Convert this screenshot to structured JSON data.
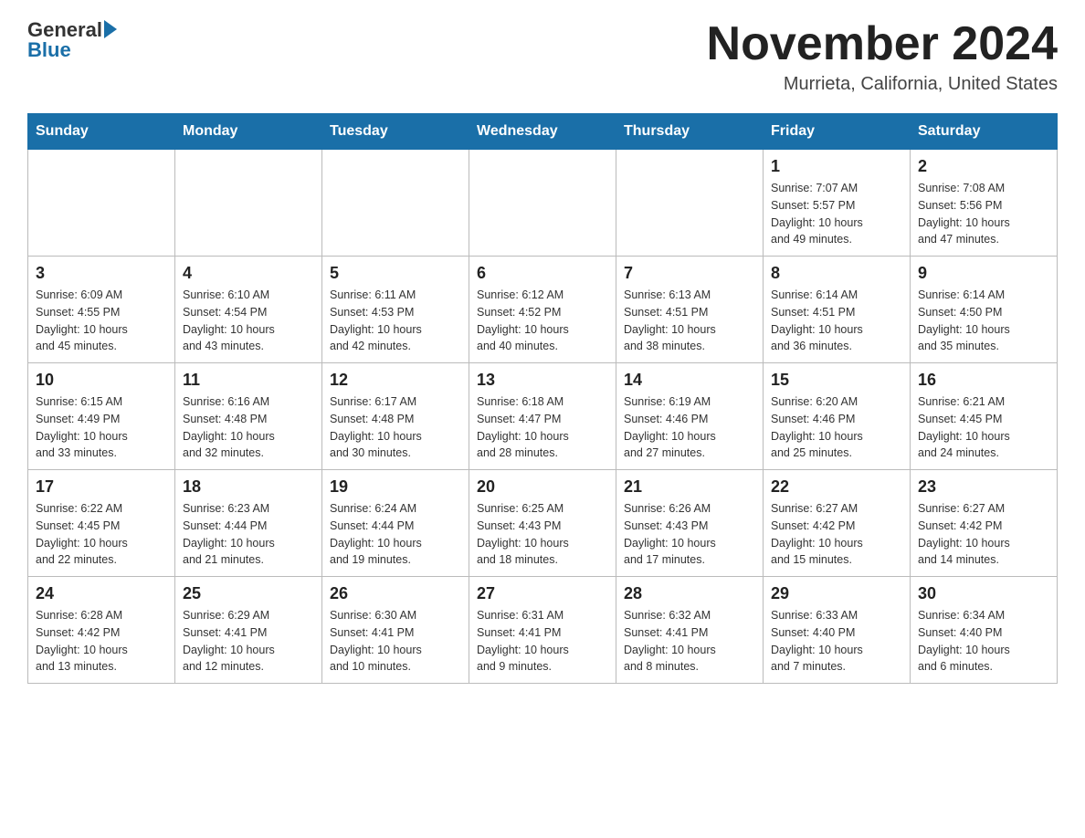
{
  "header": {
    "logo_general": "General",
    "logo_blue": "Blue",
    "title": "November 2024",
    "subtitle": "Murrieta, California, United States"
  },
  "days_of_week": [
    "Sunday",
    "Monday",
    "Tuesday",
    "Wednesday",
    "Thursday",
    "Friday",
    "Saturday"
  ],
  "weeks": [
    [
      {
        "day": "",
        "info": ""
      },
      {
        "day": "",
        "info": ""
      },
      {
        "day": "",
        "info": ""
      },
      {
        "day": "",
        "info": ""
      },
      {
        "day": "",
        "info": ""
      },
      {
        "day": "1",
        "info": "Sunrise: 7:07 AM\nSunset: 5:57 PM\nDaylight: 10 hours\nand 49 minutes."
      },
      {
        "day": "2",
        "info": "Sunrise: 7:08 AM\nSunset: 5:56 PM\nDaylight: 10 hours\nand 47 minutes."
      }
    ],
    [
      {
        "day": "3",
        "info": "Sunrise: 6:09 AM\nSunset: 4:55 PM\nDaylight: 10 hours\nand 45 minutes."
      },
      {
        "day": "4",
        "info": "Sunrise: 6:10 AM\nSunset: 4:54 PM\nDaylight: 10 hours\nand 43 minutes."
      },
      {
        "day": "5",
        "info": "Sunrise: 6:11 AM\nSunset: 4:53 PM\nDaylight: 10 hours\nand 42 minutes."
      },
      {
        "day": "6",
        "info": "Sunrise: 6:12 AM\nSunset: 4:52 PM\nDaylight: 10 hours\nand 40 minutes."
      },
      {
        "day": "7",
        "info": "Sunrise: 6:13 AM\nSunset: 4:51 PM\nDaylight: 10 hours\nand 38 minutes."
      },
      {
        "day": "8",
        "info": "Sunrise: 6:14 AM\nSunset: 4:51 PM\nDaylight: 10 hours\nand 36 minutes."
      },
      {
        "day": "9",
        "info": "Sunrise: 6:14 AM\nSunset: 4:50 PM\nDaylight: 10 hours\nand 35 minutes."
      }
    ],
    [
      {
        "day": "10",
        "info": "Sunrise: 6:15 AM\nSunset: 4:49 PM\nDaylight: 10 hours\nand 33 minutes."
      },
      {
        "day": "11",
        "info": "Sunrise: 6:16 AM\nSunset: 4:48 PM\nDaylight: 10 hours\nand 32 minutes."
      },
      {
        "day": "12",
        "info": "Sunrise: 6:17 AM\nSunset: 4:48 PM\nDaylight: 10 hours\nand 30 minutes."
      },
      {
        "day": "13",
        "info": "Sunrise: 6:18 AM\nSunset: 4:47 PM\nDaylight: 10 hours\nand 28 minutes."
      },
      {
        "day": "14",
        "info": "Sunrise: 6:19 AM\nSunset: 4:46 PM\nDaylight: 10 hours\nand 27 minutes."
      },
      {
        "day": "15",
        "info": "Sunrise: 6:20 AM\nSunset: 4:46 PM\nDaylight: 10 hours\nand 25 minutes."
      },
      {
        "day": "16",
        "info": "Sunrise: 6:21 AM\nSunset: 4:45 PM\nDaylight: 10 hours\nand 24 minutes."
      }
    ],
    [
      {
        "day": "17",
        "info": "Sunrise: 6:22 AM\nSunset: 4:45 PM\nDaylight: 10 hours\nand 22 minutes."
      },
      {
        "day": "18",
        "info": "Sunrise: 6:23 AM\nSunset: 4:44 PM\nDaylight: 10 hours\nand 21 minutes."
      },
      {
        "day": "19",
        "info": "Sunrise: 6:24 AM\nSunset: 4:44 PM\nDaylight: 10 hours\nand 19 minutes."
      },
      {
        "day": "20",
        "info": "Sunrise: 6:25 AM\nSunset: 4:43 PM\nDaylight: 10 hours\nand 18 minutes."
      },
      {
        "day": "21",
        "info": "Sunrise: 6:26 AM\nSunset: 4:43 PM\nDaylight: 10 hours\nand 17 minutes."
      },
      {
        "day": "22",
        "info": "Sunrise: 6:27 AM\nSunset: 4:42 PM\nDaylight: 10 hours\nand 15 minutes."
      },
      {
        "day": "23",
        "info": "Sunrise: 6:27 AM\nSunset: 4:42 PM\nDaylight: 10 hours\nand 14 minutes."
      }
    ],
    [
      {
        "day": "24",
        "info": "Sunrise: 6:28 AM\nSunset: 4:42 PM\nDaylight: 10 hours\nand 13 minutes."
      },
      {
        "day": "25",
        "info": "Sunrise: 6:29 AM\nSunset: 4:41 PM\nDaylight: 10 hours\nand 12 minutes."
      },
      {
        "day": "26",
        "info": "Sunrise: 6:30 AM\nSunset: 4:41 PM\nDaylight: 10 hours\nand 10 minutes."
      },
      {
        "day": "27",
        "info": "Sunrise: 6:31 AM\nSunset: 4:41 PM\nDaylight: 10 hours\nand 9 minutes."
      },
      {
        "day": "28",
        "info": "Sunrise: 6:32 AM\nSunset: 4:41 PM\nDaylight: 10 hours\nand 8 minutes."
      },
      {
        "day": "29",
        "info": "Sunrise: 6:33 AM\nSunset: 4:40 PM\nDaylight: 10 hours\nand 7 minutes."
      },
      {
        "day": "30",
        "info": "Sunrise: 6:34 AM\nSunset: 4:40 PM\nDaylight: 10 hours\nand 6 minutes."
      }
    ]
  ]
}
